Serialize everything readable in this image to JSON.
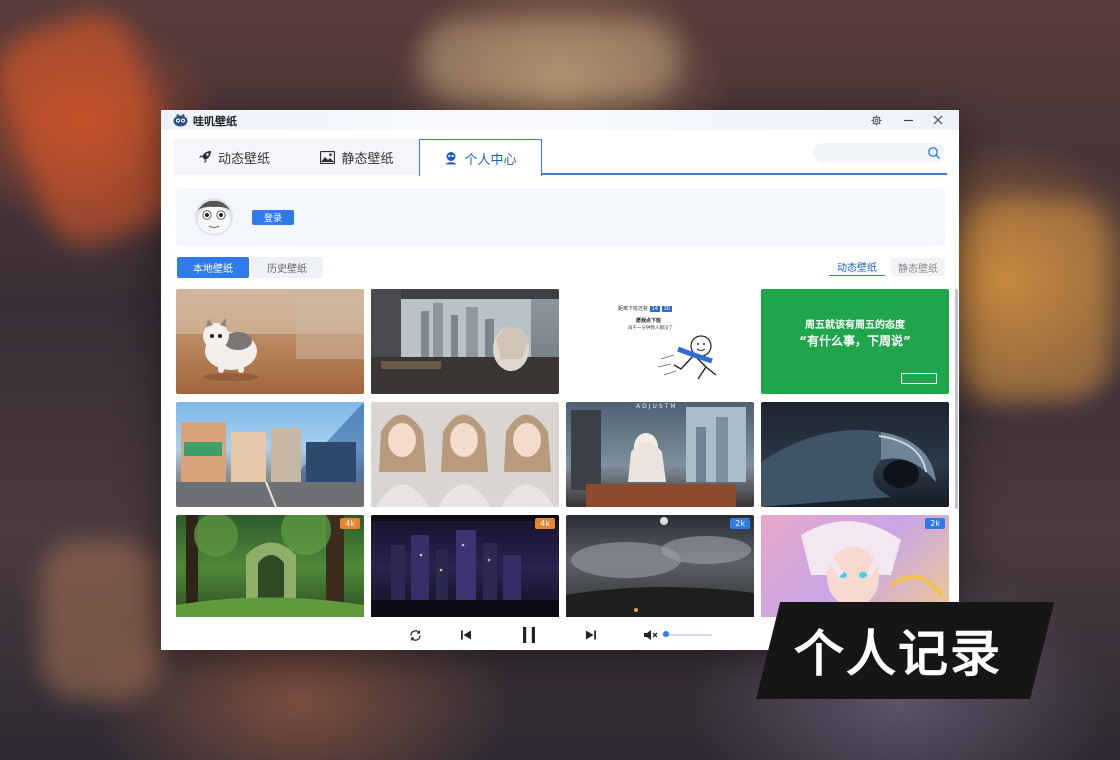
{
  "app": {
    "title": "哇叽壁纸",
    "settings_icon": "gear-icon",
    "minimize_icon": "minimize-icon",
    "close_icon": "close-icon"
  },
  "tabs": [
    {
      "label": "动态壁纸",
      "icon": "rocket-icon",
      "active": false
    },
    {
      "label": "静态壁纸",
      "icon": "image-icon",
      "active": false
    },
    {
      "label": "个人中心",
      "icon": "user-icon",
      "active": true
    }
  ],
  "search": {
    "placeholder": "",
    "value": ""
  },
  "profile": {
    "login_label": "登录"
  },
  "subtabs_left": [
    {
      "label": "本地壁纸",
      "active": true
    },
    {
      "label": "历史壁纸",
      "active": false
    }
  ],
  "subtabs_right": [
    {
      "label": "动态壁纸",
      "active": true
    },
    {
      "label": "静态壁纸",
      "active": false
    }
  ],
  "thumbnails": [
    {
      "subject": "kitten",
      "badge": ""
    },
    {
      "subject": "anime-room-city",
      "badge": ""
    },
    {
      "subject": "friday-countdown-comic",
      "badge": "",
      "lines": [
        "距离下班还有",
        "14",
        "30",
        "愿我点下班",
        "再干一分钟我人都没了"
      ]
    },
    {
      "subject": "friday-green-poster",
      "badge": "",
      "lines": [
        "周五就该有周五的态度",
        "“有什么事，下周说”"
      ]
    },
    {
      "subject": "anime-street",
      "badge": ""
    },
    {
      "subject": "girl-portraits",
      "badge": ""
    },
    {
      "subject": "anime-girl-room",
      "badge": "",
      "lines": [
        "ADJUSTM"
      ]
    },
    {
      "subject": "ocean-wave",
      "badge": ""
    },
    {
      "subject": "forest-ruins",
      "badge": "4k"
    },
    {
      "subject": "night-city",
      "badge": "4k"
    },
    {
      "subject": "storm-sky",
      "badge": "2k"
    },
    {
      "subject": "anime-boy",
      "badge": "2k"
    }
  ],
  "player": {
    "loop_icon": "repeat-icon",
    "prev_icon": "previous-icon",
    "pause_icon": "pause-icon",
    "next_icon": "next-icon",
    "mute_icon": "volume-mute-icon",
    "volume": 0.05
  },
  "caption": {
    "text": "个人记录"
  },
  "colors": {
    "accent": "#2f7bea",
    "badge_4k": "#e8832e",
    "badge_2k": "#2f7bea",
    "caption_bg": "#161616"
  }
}
